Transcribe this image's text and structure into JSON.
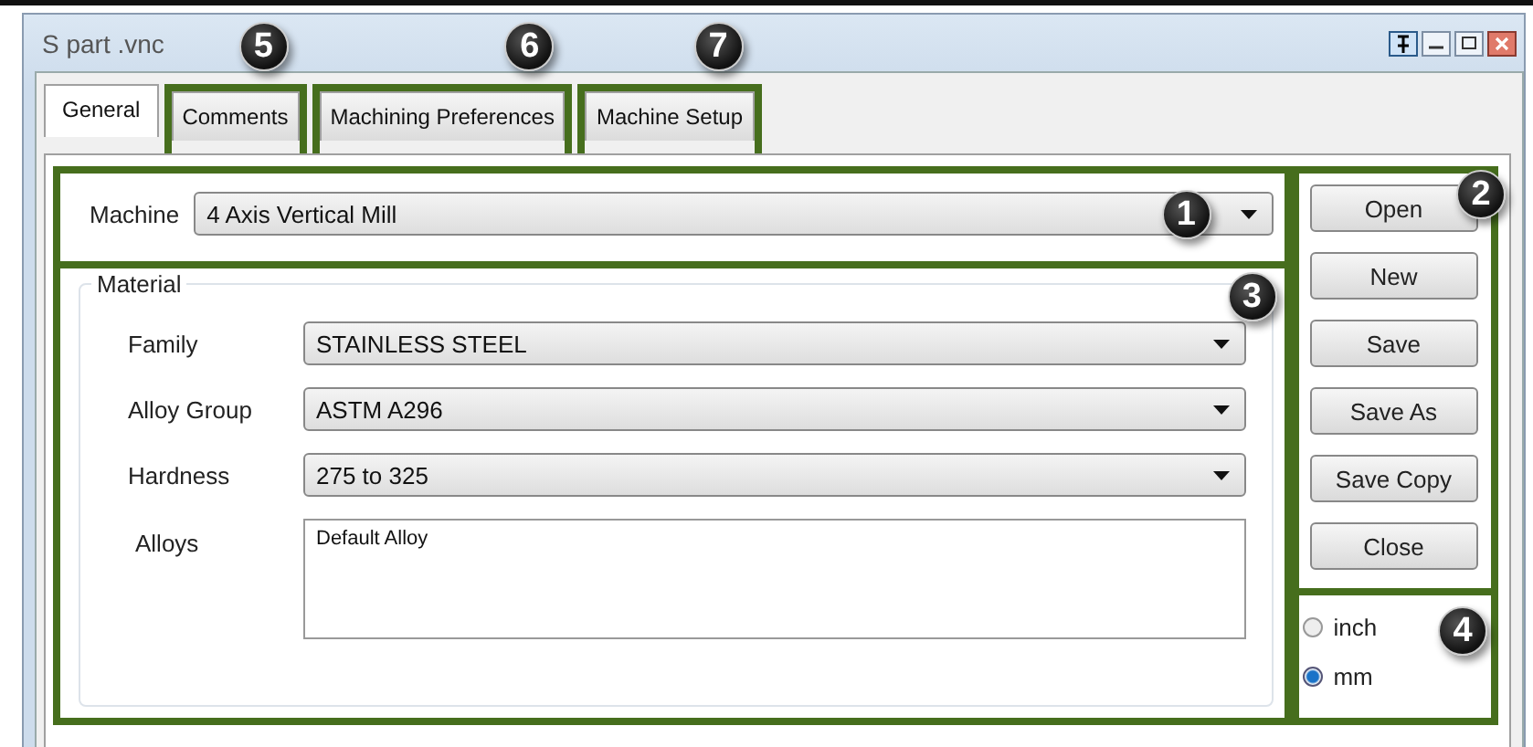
{
  "window": {
    "title": "S part .vnc"
  },
  "tabs": [
    {
      "label": "General",
      "selected": true
    },
    {
      "label": "Comments",
      "selected": false,
      "callout": "5"
    },
    {
      "label": "Machining Preferences",
      "selected": false,
      "callout": "6"
    },
    {
      "label": "Machine Setup",
      "selected": false,
      "callout": "7"
    }
  ],
  "machine": {
    "label": "Machine",
    "value": "4 Axis Vertical Mill",
    "callout": "1"
  },
  "material": {
    "title": "Material",
    "callout": "3",
    "fields": [
      {
        "label": "Family",
        "value": "STAINLESS STEEL"
      },
      {
        "label": "Alloy Group",
        "value": "ASTM A296"
      },
      {
        "label": "Hardness",
        "value": "275 to 325"
      }
    ],
    "alloys": {
      "label": "Alloys",
      "items": [
        "Default Alloy"
      ]
    }
  },
  "buttons": {
    "callout": "2",
    "items": [
      "Open",
      "New",
      "Save",
      "Save As",
      "Save Copy",
      "Close"
    ]
  },
  "units": {
    "callout": "4",
    "options": [
      {
        "label": "inch",
        "selected": false
      },
      {
        "label": "mm",
        "selected": true
      }
    ]
  }
}
